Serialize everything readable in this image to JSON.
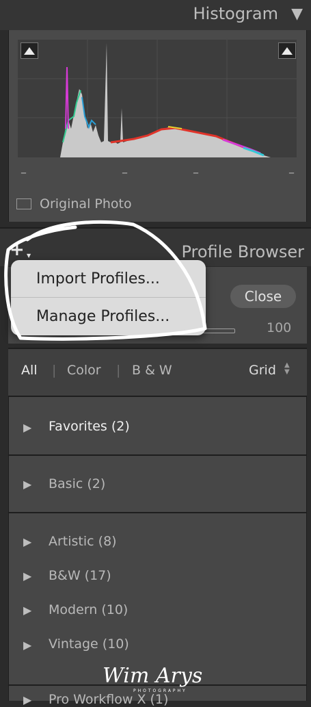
{
  "histogram": {
    "title": "Histogram",
    "collapse_icon": "triangle-down-icon",
    "shadow_clip_icon": "triangle-up-icon",
    "highlight_clip_icon": "triangle-up-icon",
    "ticks": [
      "–",
      "–",
      "–",
      "–"
    ],
    "original_photo_label": "Original Photo"
  },
  "profile_browser": {
    "title": "Profile Browser",
    "plus_icon": "plus-icon",
    "close_label": "Close",
    "amount_value": "100",
    "menu": {
      "items": [
        {
          "label": "Import Profiles..."
        },
        {
          "label": "Manage Profiles..."
        }
      ]
    },
    "filters": {
      "all": "All",
      "color": "Color",
      "bw": "B & W",
      "view": "Grid",
      "separator": "|"
    },
    "groups": [
      {
        "label": "Favorites (2)"
      },
      {
        "label": "Basic (2)"
      },
      {
        "label": "Artistic (8)"
      },
      {
        "label": "B&W (17)"
      },
      {
        "label": "Modern (10)"
      },
      {
        "label": "Vintage (10)"
      },
      {
        "label": "Pro Workflow X (1)"
      }
    ],
    "disclosure_glyph": "▶"
  },
  "watermark": {
    "signature": "Wim Arys",
    "subtitle": "PHOTOGRAPHY"
  },
  "colors": {
    "panel_bg": "#474747",
    "header_bg": "#353535",
    "menu_bg": "#dcdcdc",
    "annotation": "#ffffff"
  }
}
